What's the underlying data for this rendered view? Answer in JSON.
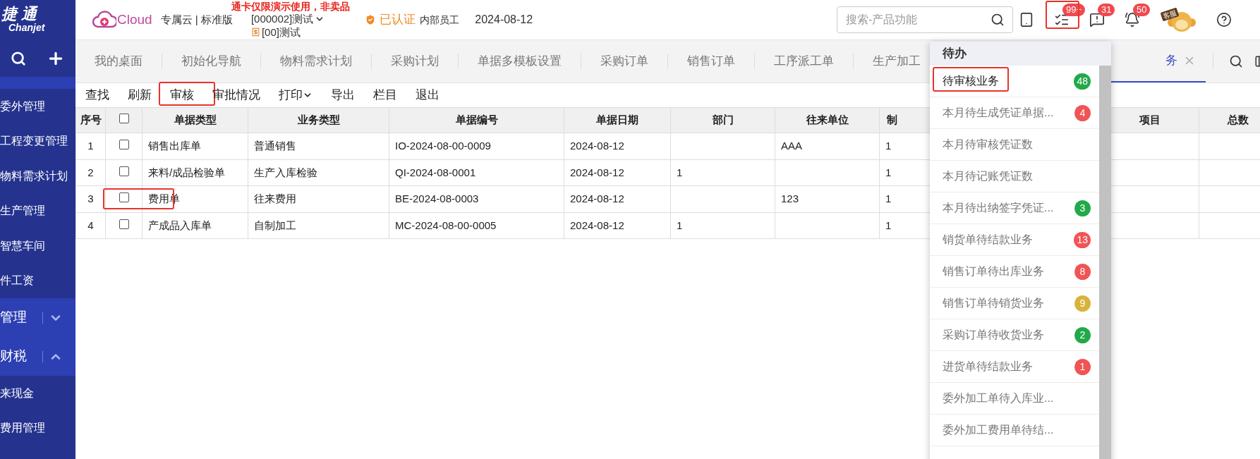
{
  "sidebar": {
    "logo": {
      "name": "捷通",
      "latin": "Chanjet"
    },
    "items": [
      {
        "kind": "item",
        "label": "委外管理"
      },
      {
        "kind": "item",
        "label": "工程变更管理"
      },
      {
        "kind": "item",
        "label": "物料需求计划"
      },
      {
        "kind": "item",
        "label": "生产管理"
      },
      {
        "kind": "item",
        "label": "智慧车间"
      },
      {
        "kind": "item",
        "label": "件工资"
      },
      {
        "kind": "group",
        "label": "管理",
        "expanded": false
      },
      {
        "kind": "group",
        "label": "财税",
        "expanded": true
      },
      {
        "kind": "item",
        "label": "来现金"
      },
      {
        "kind": "item",
        "label": "费用管理"
      }
    ]
  },
  "header": {
    "product": "Cloud",
    "edition": "专属云 | 标准版",
    "demo_notice": "通卡仅限演示使用，非卖品",
    "account": "[000002]测试",
    "org": "[00]测试",
    "certified": "已认证",
    "role": "内部员工",
    "date": "2024-08-12",
    "search": {
      "placeholder": "搜索-产品功能"
    },
    "icons": [
      {
        "kind": "tablet",
        "annotated": false
      },
      {
        "kind": "todo",
        "badge": "99+",
        "annotated": true
      },
      {
        "kind": "chat",
        "badge": "31",
        "annotated": false
      },
      {
        "kind": "bell",
        "badge": "50",
        "annotated": false
      },
      {
        "kind": "service",
        "label": "客服",
        "annotated": false
      },
      {
        "kind": "help",
        "annotated": false
      }
    ]
  },
  "tabs": [
    {
      "label": "我的桌面",
      "selected": false
    },
    {
      "label": "初始化导航",
      "selected": false
    },
    {
      "label": "物料需求计划",
      "selected": false
    },
    {
      "label": "采购计划",
      "selected": false
    },
    {
      "label": "单据多模板设置",
      "selected": false
    },
    {
      "label": "采购订单",
      "selected": false
    },
    {
      "label": "销售订单",
      "selected": false
    },
    {
      "label": "工序派工单",
      "selected": false
    },
    {
      "label": "生产加工",
      "selected": false
    },
    {
      "label": "务",
      "selected": true,
      "closable": true
    }
  ],
  "toolbar": [
    {
      "label": "查找",
      "annotated": false
    },
    {
      "label": "刷新",
      "annotated": false
    },
    {
      "label": "审核",
      "annotated": true
    },
    {
      "label": "审批情况",
      "annotated": false
    },
    {
      "label": "打印",
      "annotated": false,
      "menu": true
    },
    {
      "label": "导出",
      "annotated": false
    },
    {
      "label": "栏目",
      "annotated": false
    },
    {
      "label": "退出",
      "annotated": false
    }
  ],
  "table": {
    "all_checked": false,
    "columns": [
      "序号",
      "单据类型",
      "业务类型",
      "单据编号",
      "单据日期",
      "部门",
      "往来单位",
      "制",
      "项目",
      "总数"
    ],
    "rows": [
      {
        "checked": false,
        "annotated": false,
        "cells": [
          "1",
          "销售出库单",
          "普通销售",
          "IO-2024-08-00-0009",
          "2024-08-12",
          "",
          "AAA",
          "1",
          "",
          ""
        ]
      },
      {
        "checked": false,
        "annotated": false,
        "cells": [
          "2",
          "来料/成品检验单",
          "生产入库检验",
          "QI-2024-08-0001",
          "2024-08-12",
          "1",
          "",
          "1",
          "",
          ""
        ]
      },
      {
        "checked": false,
        "annotated": true,
        "cells": [
          "3",
          "费用单",
          "往来费用",
          "BE-2024-08-0003",
          "2024-08-12",
          "",
          "123",
          "1",
          "",
          ""
        ]
      },
      {
        "checked": false,
        "annotated": false,
        "cells": [
          "4",
          "产成品入库单",
          "自制加工",
          "MC-2024-08-00-0005",
          "2024-08-12",
          "1",
          "",
          "1",
          "",
          ""
        ]
      }
    ]
  },
  "todo_panel": {
    "title": "待办",
    "items": [
      {
        "label": "待审核业务",
        "count": "48",
        "color": "#22a94a",
        "selected": true,
        "annotated": true
      },
      {
        "label": "本月待生成凭证单据...",
        "count": "4",
        "color": "#f05454",
        "selected": false,
        "annotated": false
      },
      {
        "label": "本月待审核凭证数",
        "selected": false,
        "annotated": false
      },
      {
        "label": "本月待记账凭证数",
        "selected": false,
        "annotated": false
      },
      {
        "label": "本月待出纳签字凭证...",
        "count": "3",
        "color": "#22a94a",
        "selected": false,
        "annotated": false
      },
      {
        "label": "销货单待结款业务",
        "count": "13",
        "color": "#f05454",
        "selected": false,
        "annotated": false
      },
      {
        "label": "销售订单待出库业务",
        "count": "8",
        "color": "#f05454",
        "selected": false,
        "annotated": false
      },
      {
        "label": "销售订单待销货业务",
        "count": "9",
        "color": "#d9b23a",
        "selected": false,
        "annotated": false
      },
      {
        "label": "采购订单待收货业务",
        "count": "2",
        "color": "#22a94a",
        "selected": false,
        "annotated": false
      },
      {
        "label": "进货单待结款业务",
        "count": "1",
        "color": "#f05454",
        "selected": false,
        "annotated": false
      },
      {
        "label": "委外加工单待入库业...",
        "selected": false,
        "annotated": false
      },
      {
        "label": "委外加工费用单待结...",
        "selected": false,
        "annotated": false
      }
    ]
  }
}
